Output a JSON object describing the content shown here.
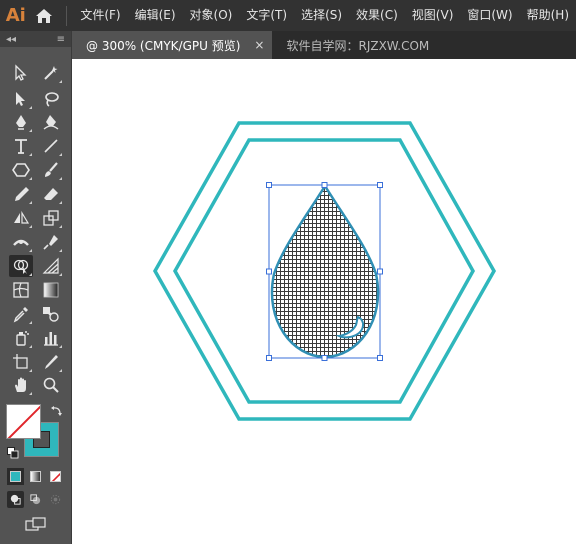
{
  "app": {
    "logo": "Ai"
  },
  "menu": [
    "文件(F)",
    "编辑(E)",
    "对象(O)",
    "文字(T)",
    "选择(S)",
    "效果(C)",
    "视图(V)",
    "窗口(W)",
    "帮助(H)"
  ],
  "tabs": [
    {
      "label": "@ 300% (CMYK/GPU 预览)",
      "close": "×"
    },
    {
      "label": "软件自学网：RJZXW.COM"
    }
  ],
  "tools_header": {
    "collapse": "◂◂",
    "menu": "≡"
  },
  "colors": {
    "accent": "#2fb7bc",
    "selection": "#3a6fd8",
    "drop_stroke": "#2f8fb4",
    "panel": "#535353",
    "menubar": "#323232"
  }
}
